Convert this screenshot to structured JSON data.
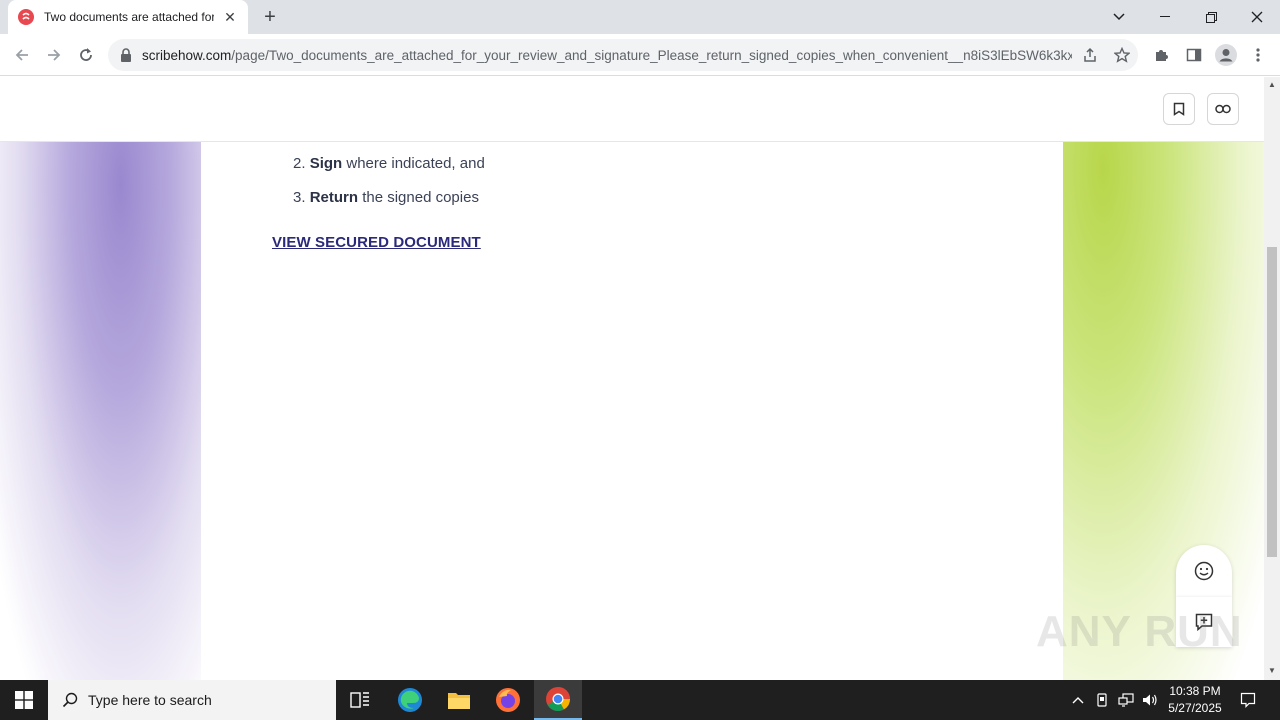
{
  "browser": {
    "tab_title": "Two documents are attached for your review and signature",
    "url_domain": "scribehow.com",
    "url_path": "/page/Two_documents_are_attached_for_your_review_and_signature_Please_return_signed_copies_when_convenient__n8iS3lEbSW6k3kx..."
  },
  "page": {
    "list_items": [
      {
        "number": "2.",
        "bold": "Sign",
        "rest": " where indicated, and"
      },
      {
        "number": "3.",
        "bold": "Return",
        "rest": " the signed copies"
      }
    ],
    "link_text": "VIEW SECURED DOCUMENT",
    "watermark": "ANY RUN"
  },
  "taskbar": {
    "search_placeholder": "Type here to search",
    "time": "10:38 PM",
    "date": "5/27/2025"
  }
}
